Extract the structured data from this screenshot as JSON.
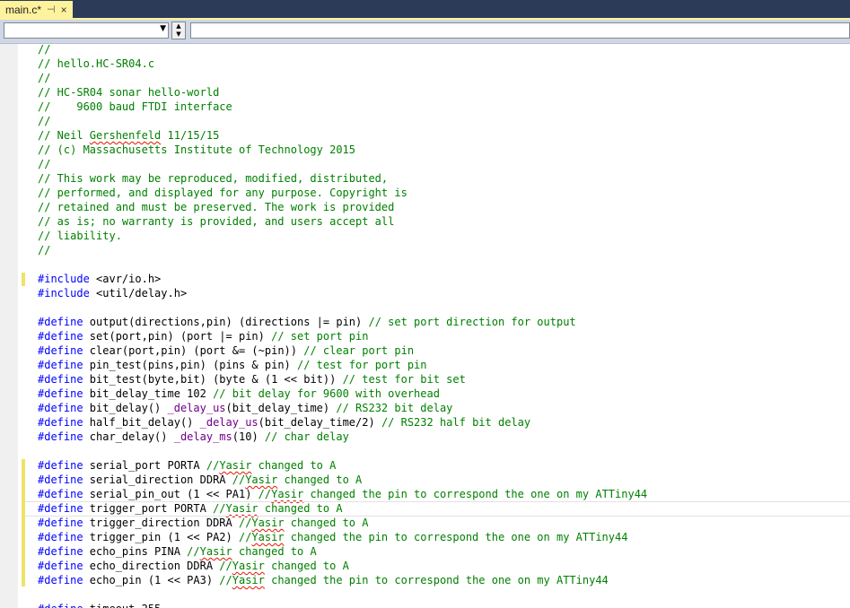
{
  "tab": {
    "title": "main.c*",
    "pin_glyph": "⊣",
    "close_glyph": "×"
  },
  "navigation": {
    "scope_value": "",
    "member_value": ""
  },
  "code_lines": [
    [
      {
        "t": "//",
        "c": "comment"
      }
    ],
    [
      {
        "t": "// hello.HC-SR04.c",
        "c": "comment"
      }
    ],
    [
      {
        "t": "//",
        "c": "comment"
      }
    ],
    [
      {
        "t": "// HC-SR04 sonar hello-world",
        "c": "comment"
      }
    ],
    [
      {
        "t": "//    9600 baud FTDI interface",
        "c": "comment"
      }
    ],
    [
      {
        "t": "//",
        "c": "comment"
      }
    ],
    [
      {
        "t": "// Neil ",
        "c": "comment"
      },
      {
        "t": "Gershenfeld",
        "c": "comment",
        "sq": true
      },
      {
        "t": " 11/15/15",
        "c": "comment"
      }
    ],
    [
      {
        "t": "// (c) Massachusetts Institute of Technology 2015",
        "c": "comment"
      }
    ],
    [
      {
        "t": "//",
        "c": "comment"
      }
    ],
    [
      {
        "t": "// This work may be reproduced, modified, distributed,",
        "c": "comment"
      }
    ],
    [
      {
        "t": "// performed, and displayed for any purpose. Copyright is",
        "c": "comment"
      }
    ],
    [
      {
        "t": "// retained and must be preserved. The work is provided",
        "c": "comment"
      }
    ],
    [
      {
        "t": "// as is; no warranty is provided, and users accept all",
        "c": "comment"
      }
    ],
    [
      {
        "t": "// liability.",
        "c": "comment"
      }
    ],
    [
      {
        "t": "//",
        "c": "comment"
      }
    ],
    [],
    [
      {
        "t": "#include",
        "c": "keyword"
      },
      {
        "t": " <avr/io.h>",
        "c": "text"
      }
    ],
    [
      {
        "t": "#include",
        "c": "keyword"
      },
      {
        "t": " <util/delay.h>",
        "c": "text"
      }
    ],
    [],
    [
      {
        "t": "#define",
        "c": "keyword"
      },
      {
        "t": " output(directions,pin) (directions |= pin) ",
        "c": "text"
      },
      {
        "t": "// set port direction for output",
        "c": "comment"
      }
    ],
    [
      {
        "t": "#define",
        "c": "keyword"
      },
      {
        "t": " set(port,pin) (port |= pin) ",
        "c": "text"
      },
      {
        "t": "// set port pin",
        "c": "comment"
      }
    ],
    [
      {
        "t": "#define",
        "c": "keyword"
      },
      {
        "t": " clear(port,pin) (port &= (~pin)) ",
        "c": "text"
      },
      {
        "t": "// clear port pin",
        "c": "comment"
      }
    ],
    [
      {
        "t": "#define",
        "c": "keyword"
      },
      {
        "t": " pin_test(pins,pin) (pins & pin) ",
        "c": "text"
      },
      {
        "t": "// test for port pin",
        "c": "comment"
      }
    ],
    [
      {
        "t": "#define",
        "c": "keyword"
      },
      {
        "t": " bit_test(byte,bit) (byte & (1 << bit)) ",
        "c": "text"
      },
      {
        "t": "// test for bit set",
        "c": "comment"
      }
    ],
    [
      {
        "t": "#define",
        "c": "keyword"
      },
      {
        "t": " bit_delay_time 102 ",
        "c": "text"
      },
      {
        "t": "// bit delay for 9600 with overhead",
        "c": "comment"
      }
    ],
    [
      {
        "t": "#define",
        "c": "keyword"
      },
      {
        "t": " bit_delay() ",
        "c": "text"
      },
      {
        "t": "_delay_us",
        "c": "macro"
      },
      {
        "t": "(bit_delay_time) ",
        "c": "text"
      },
      {
        "t": "// RS232 bit delay",
        "c": "comment"
      }
    ],
    [
      {
        "t": "#define",
        "c": "keyword"
      },
      {
        "t": " half_bit_delay() ",
        "c": "text"
      },
      {
        "t": "_delay_us",
        "c": "macro"
      },
      {
        "t": "(bit_delay_time/2) ",
        "c": "text"
      },
      {
        "t": "// RS232 half bit delay",
        "c": "comment"
      }
    ],
    [
      {
        "t": "#define",
        "c": "keyword"
      },
      {
        "t": " char_delay() ",
        "c": "text"
      },
      {
        "t": "_delay_ms",
        "c": "macro"
      },
      {
        "t": "(10) ",
        "c": "text"
      },
      {
        "t": "// char delay",
        "c": "comment"
      }
    ],
    [],
    [
      {
        "t": "#define",
        "c": "keyword"
      },
      {
        "t": " serial_port PORTA ",
        "c": "text"
      },
      {
        "t": "//",
        "c": "comment"
      },
      {
        "t": "Yasir",
        "c": "comment",
        "sq": true
      },
      {
        "t": " changed to A",
        "c": "comment"
      }
    ],
    [
      {
        "t": "#define",
        "c": "keyword"
      },
      {
        "t": " serial_direction DDRA ",
        "c": "text"
      },
      {
        "t": "//",
        "c": "comment"
      },
      {
        "t": "Yasir",
        "c": "comment",
        "sq": true
      },
      {
        "t": " changed to A",
        "c": "comment"
      }
    ],
    [
      {
        "t": "#define",
        "c": "keyword"
      },
      {
        "t": " serial_pin_out (1 << PA1) ",
        "c": "text"
      },
      {
        "t": "//",
        "c": "comment"
      },
      {
        "t": "Yasir",
        "c": "comment",
        "sq": true
      },
      {
        "t": " changed the pin to correspond the one on my ATTiny44",
        "c": "comment"
      }
    ],
    [
      {
        "t": "#define",
        "c": "keyword"
      },
      {
        "t": " trigger_port PORTA ",
        "c": "text"
      },
      {
        "t": "//",
        "c": "comment"
      },
      {
        "t": "Yasir",
        "c": "comment",
        "sq": true
      },
      {
        "t": " changed to A",
        "c": "comment"
      }
    ],
    [
      {
        "t": "#define",
        "c": "keyword"
      },
      {
        "t": " trigger_direction DDRA ",
        "c": "text"
      },
      {
        "t": "//",
        "c": "comment"
      },
      {
        "t": "Yasir",
        "c": "comment",
        "sq": true
      },
      {
        "t": " changed to A",
        "c": "comment"
      }
    ],
    [
      {
        "t": "#define",
        "c": "keyword"
      },
      {
        "t": " trigger_pin (1 << PA2) ",
        "c": "text"
      },
      {
        "t": "//",
        "c": "comment"
      },
      {
        "t": "Yasir",
        "c": "comment",
        "sq": true
      },
      {
        "t": " changed the pin to correspond the one on my ATTiny44",
        "c": "comment"
      }
    ],
    [
      {
        "t": "#define",
        "c": "keyword"
      },
      {
        "t": " echo_pins PINA ",
        "c": "text"
      },
      {
        "t": "//",
        "c": "comment"
      },
      {
        "t": "Yasir",
        "c": "comment",
        "sq": true
      },
      {
        "t": " changed to A",
        "c": "comment"
      }
    ],
    [
      {
        "t": "#define",
        "c": "keyword"
      },
      {
        "t": " echo_direction DDRA ",
        "c": "text"
      },
      {
        "t": "//",
        "c": "comment"
      },
      {
        "t": "Yasir",
        "c": "comment",
        "sq": true
      },
      {
        "t": " changed to A",
        "c": "comment"
      }
    ],
    [
      {
        "t": "#define",
        "c": "keyword"
      },
      {
        "t": " echo_pin (1 << PA3) ",
        "c": "text"
      },
      {
        "t": "//",
        "c": "comment"
      },
      {
        "t": "Yasir",
        "c": "comment",
        "sq": true
      },
      {
        "t": " changed the pin to correspond the one on my ATTiny44",
        "c": "comment"
      }
    ],
    [],
    [
      {
        "t": "#define",
        "c": "keyword"
      },
      {
        "t": " timeout 255",
        "c": "text"
      }
    ]
  ],
  "current_line": 32,
  "colors": {
    "tab_background": "#fff29d",
    "tab_strip": "#2b3b58",
    "comment": "#008000",
    "keyword": "#0000ff",
    "macro": "#6f008a",
    "change_marker": "#efe26a",
    "squiggle": "#e51400"
  }
}
